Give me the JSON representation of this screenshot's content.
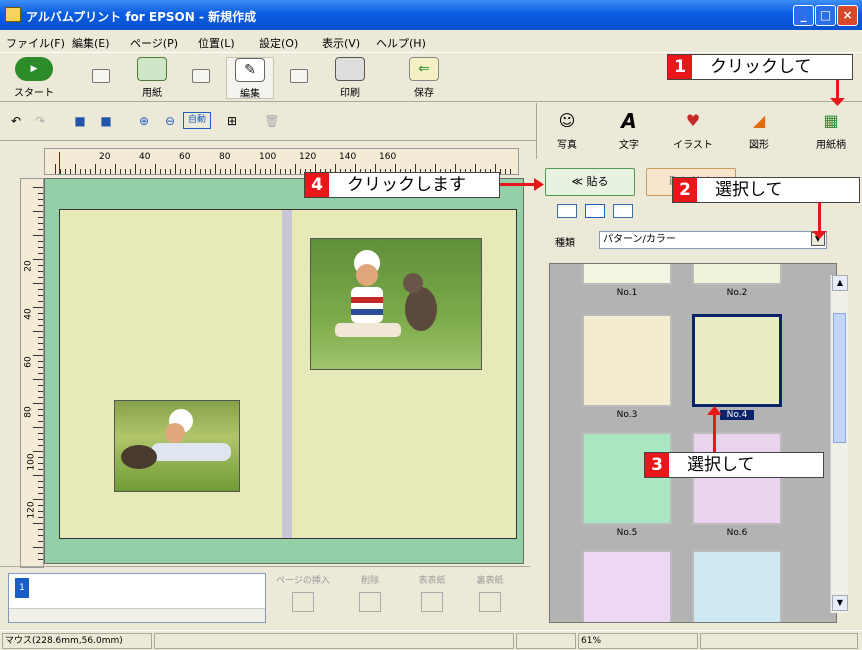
{
  "window": {
    "title": "アルバムプリント for EPSON - 新規作成"
  },
  "menu": [
    "ファイル(F)",
    "編集(E)",
    "ページ(P)",
    "位置(L)",
    "設定(O)",
    "表示(V)",
    "ヘルプ(H)"
  ],
  "modes": [
    {
      "label": "スタート",
      "icon": "start-icon"
    },
    {
      "label": "用紙",
      "icon": "paper-icon"
    },
    {
      "label": "編集",
      "icon": "edit-icon"
    },
    {
      "label": "印刷",
      "icon": "print-icon"
    },
    {
      "label": "保存",
      "icon": "save-icon"
    }
  ],
  "toolbar": {
    "auto_label": "自動"
  },
  "right_tools": [
    {
      "label": "写真",
      "icon": "photo-icon"
    },
    {
      "label": "文字",
      "icon": "text-icon"
    },
    {
      "label": "イラスト",
      "icon": "illustration-icon"
    },
    {
      "label": "図形",
      "icon": "shape-icon"
    },
    {
      "label": "用紙柄",
      "icon": "paper-pattern-icon"
    }
  ],
  "ruler": {
    "h_labels": [
      "20",
      "40",
      "60",
      "80",
      "100",
      "120",
      "140",
      "160"
    ],
    "v_labels": [
      "20",
      "40",
      "60",
      "80",
      "100",
      "120"
    ]
  },
  "paste_button": "≪ 貼る",
  "remove_button": "取り外す",
  "panel": {
    "kind_label": "種類",
    "kind_value": "パターン/カラー"
  },
  "patterns": [
    {
      "label": "No.1"
    },
    {
      "label": "No.2"
    },
    {
      "label": "No.3"
    },
    {
      "label": "No.4",
      "selected": true
    },
    {
      "label": "No.5"
    },
    {
      "label": "No.6"
    }
  ],
  "bottom": {
    "insert_page": "ページの挿入",
    "delete": "削除",
    "front_cover": "表表紙",
    "back_cover": "裏表紙"
  },
  "status": {
    "mouse": "マウス(228.6mm,56.0mm)",
    "zoom": "61%"
  },
  "callouts": [
    {
      "num": "1",
      "text": "クリックして"
    },
    {
      "num": "2",
      "text": "選択して"
    },
    {
      "num": "3",
      "text": "選択して"
    },
    {
      "num": "4",
      "text": "クリックします"
    }
  ],
  "colors": {
    "callout": "#e8181a",
    "titlebar": "#0a5ce0",
    "canvas": "#94cfa8",
    "page": "#e8e9b8"
  }
}
